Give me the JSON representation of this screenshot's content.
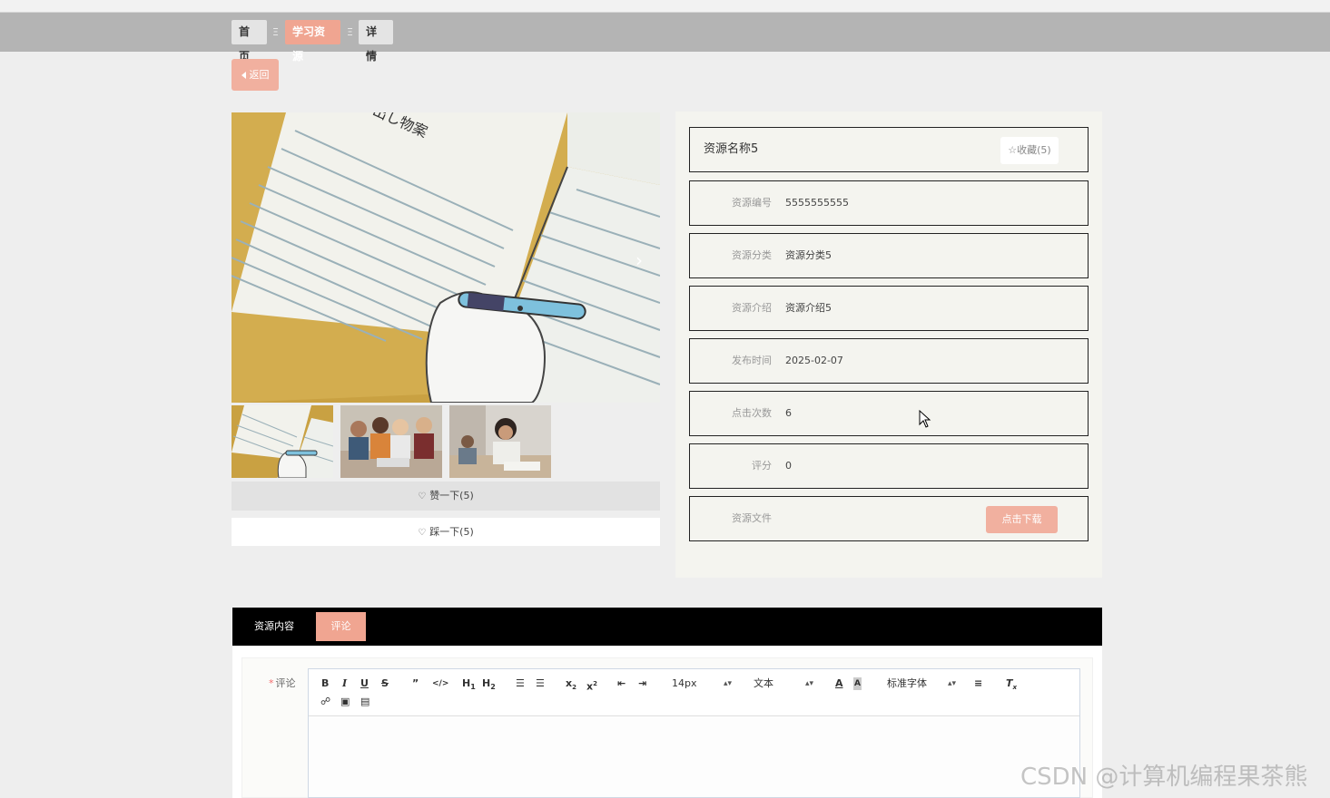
{
  "breadcrumb": {
    "home": "首页",
    "separator": "Ξ",
    "resources": "学习资源",
    "detail": "详情"
  },
  "back_button": "返回",
  "actions": {
    "like": "赞一下(5)",
    "dislike": "踩一下(5)"
  },
  "resource": {
    "name": "资源名称5",
    "favorite": "收藏(5)",
    "rows": [
      {
        "label": "资源编号",
        "value": "5555555555"
      },
      {
        "label": "资源分类",
        "value": "资源分类5"
      },
      {
        "label": "资源介绍",
        "value": "资源介绍5"
      },
      {
        "label": "发布时间",
        "value": "2025-02-07"
      },
      {
        "label": "点击次数",
        "value": "6"
      },
      {
        "label": "评分",
        "value": "0"
      }
    ],
    "file_label": "资源文件",
    "download": "点击下载"
  },
  "tabs": {
    "content": "资源内容",
    "comment": "评论"
  },
  "comment_form": {
    "required_mark": "*",
    "label": "评论",
    "toolbar": {
      "font_size": "14px",
      "text_type": "文本",
      "font_family": "标准字体"
    }
  },
  "watermark": "CSDN @计算机编程果茶熊",
  "colors": {
    "accent": "#f0a591",
    "accent_light": "#f1b09f",
    "breadcrumb_bar": "#b4b4b4",
    "tab_bar": "#000000"
  }
}
